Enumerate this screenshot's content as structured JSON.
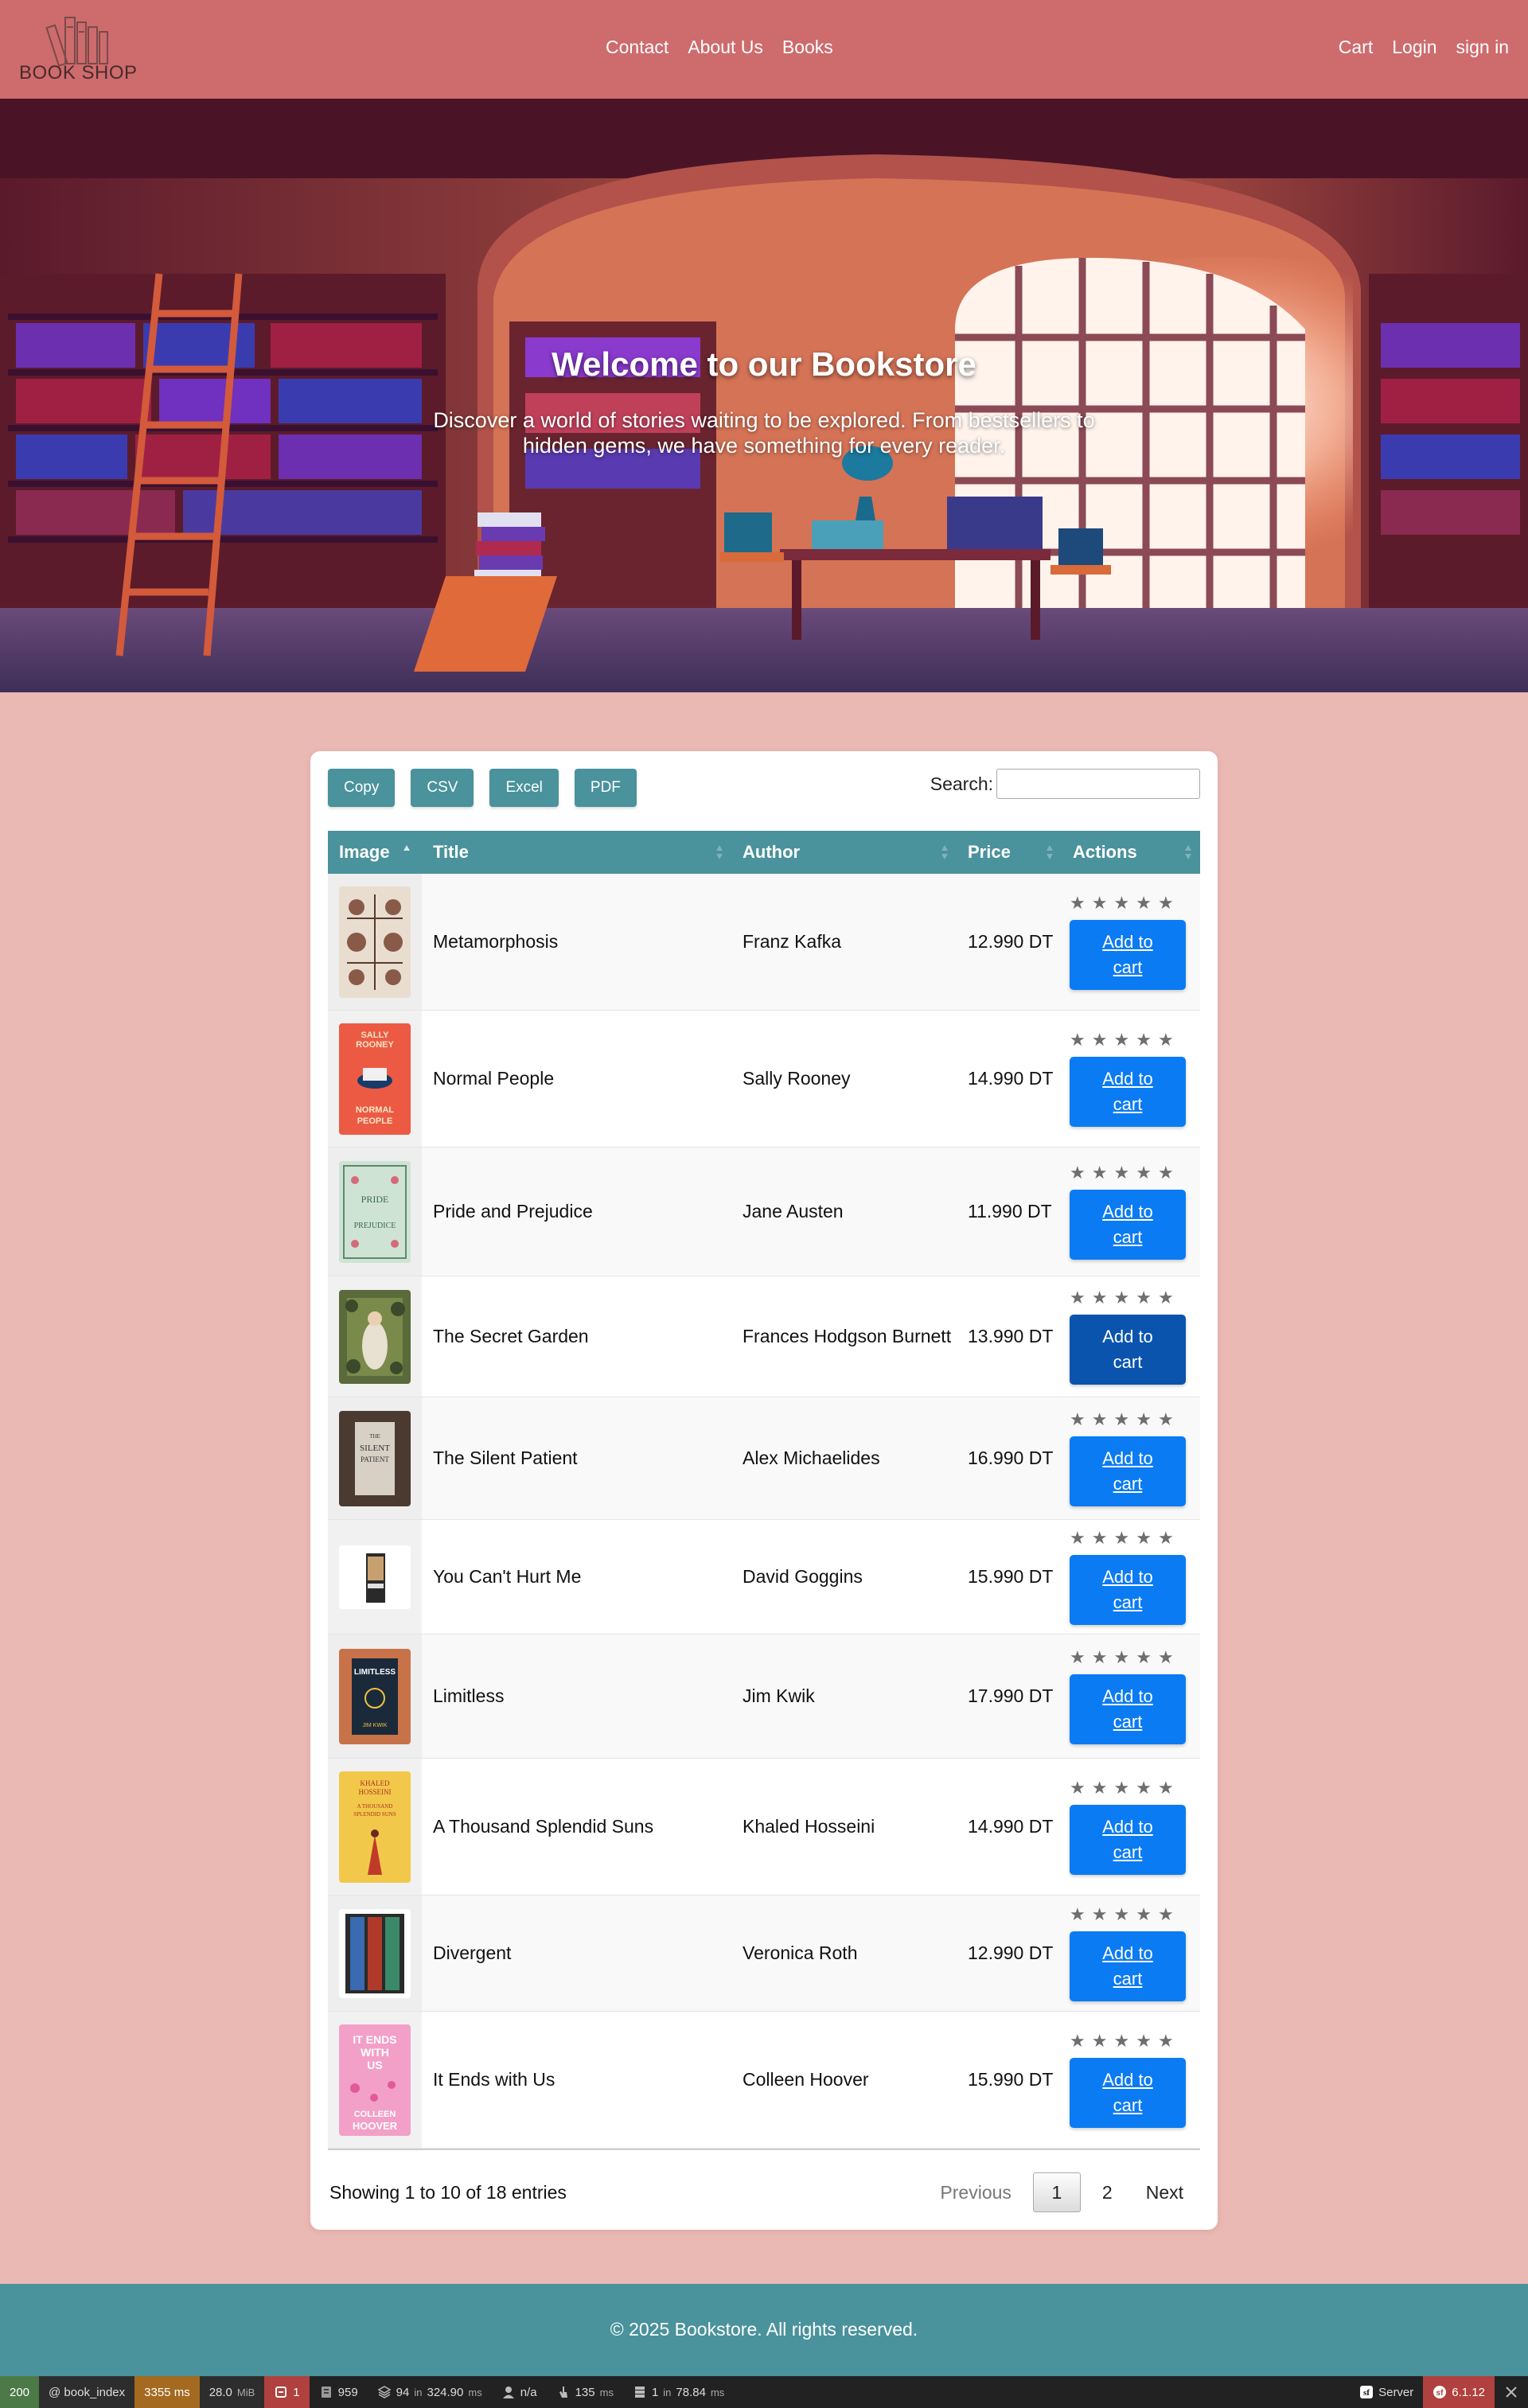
{
  "nav": {
    "logo_text": "BOOK SHOP",
    "center_links": [
      "Contact",
      "About Us",
      "Books"
    ],
    "right_links": [
      "Cart",
      "Login",
      "sign in"
    ]
  },
  "hero": {
    "title": "Welcome to our Bookstore",
    "subtitle": "Discover a world of stories waiting to be explored. From bestsellers to hidden gems, we have something for every reader."
  },
  "table": {
    "buttons": [
      "Copy",
      "CSV",
      "Excel",
      "PDF"
    ],
    "search_label": "Search:",
    "search_value": "",
    "columns": [
      "Image",
      "Title",
      "Author",
      "Price",
      "Actions"
    ],
    "add_label": "Add to cart",
    "rating_max": 5,
    "rows": [
      {
        "title": "Metamorphosis",
        "author": "Franz Kafka",
        "price": "12.990 DT"
      },
      {
        "title": "Normal People",
        "author": "Sally Rooney",
        "price": "14.990 DT"
      },
      {
        "title": "Pride and Prejudice",
        "author": "Jane Austen",
        "price": "11.990 DT"
      },
      {
        "title": "The Secret Garden",
        "author": "Frances Hodgson Burnett",
        "price": "13.990 DT"
      },
      {
        "title": "The Silent Patient",
        "author": "Alex Michaelides",
        "price": "16.990 DT"
      },
      {
        "title": "You Can't Hurt Me",
        "author": "David Goggins",
        "price": "15.990 DT"
      },
      {
        "title": "Limitless",
        "author": "Jim Kwik",
        "price": "17.990 DT"
      },
      {
        "title": "A Thousand Splendid Suns",
        "author": "Khaled Hosseini",
        "price": "14.990 DT"
      },
      {
        "title": "Divergent",
        "author": "Veronica Roth",
        "price": "12.990 DT"
      },
      {
        "title": "It Ends with Us",
        "author": "Colleen Hoover",
        "price": "15.990 DT"
      }
    ],
    "info": "Showing 1 to 10 of 18 entries",
    "pager": {
      "previous": "Previous",
      "pages": [
        "1",
        "2"
      ],
      "current": "1",
      "next": "Next"
    }
  },
  "cover_text": {
    "normal_people": [
      "SALLY",
      "ROONEY",
      "NORMAL",
      "PEOPLE"
    ],
    "pride": [
      "PRIDE",
      "PREJUDICE"
    ],
    "silent": [
      "THE",
      "SILENT",
      "PATIENT"
    ],
    "limitless": [
      "LIMITLESS",
      "JIM KWIK"
    ],
    "splendid": [
      "KHALED",
      "HOSSEINI",
      "A THOUSAND",
      "SPLENDID SUNS"
    ],
    "ends": [
      "IT ENDS",
      "WITH",
      "US",
      "COLLEEN",
      "HOOVER"
    ]
  },
  "footer": {
    "text": "© 2025 Bookstore. All rights reserved."
  },
  "debug": {
    "status": "200",
    "route": "@ book_index",
    "time": "3355 ms",
    "memory": "28.0",
    "memory_unit": "MiB",
    "errors": "1",
    "logs": "959",
    "db_count": "94",
    "db_in": "in",
    "db_time": "324.90",
    "db_unit": "ms",
    "user": "n/a",
    "events": "135",
    "events_unit": "ms",
    "cache_count": "1",
    "cache_in": "in",
    "cache_time": "78.84",
    "cache_unit": "ms",
    "server": "Server",
    "version": "6.1.12"
  },
  "colors": {
    "navbar": "#cd6b6d",
    "page": "#ebb9b3",
    "teal": "#4a929c",
    "add_button": "#0b7bf3",
    "add_button_hover": "#0a54ae"
  }
}
